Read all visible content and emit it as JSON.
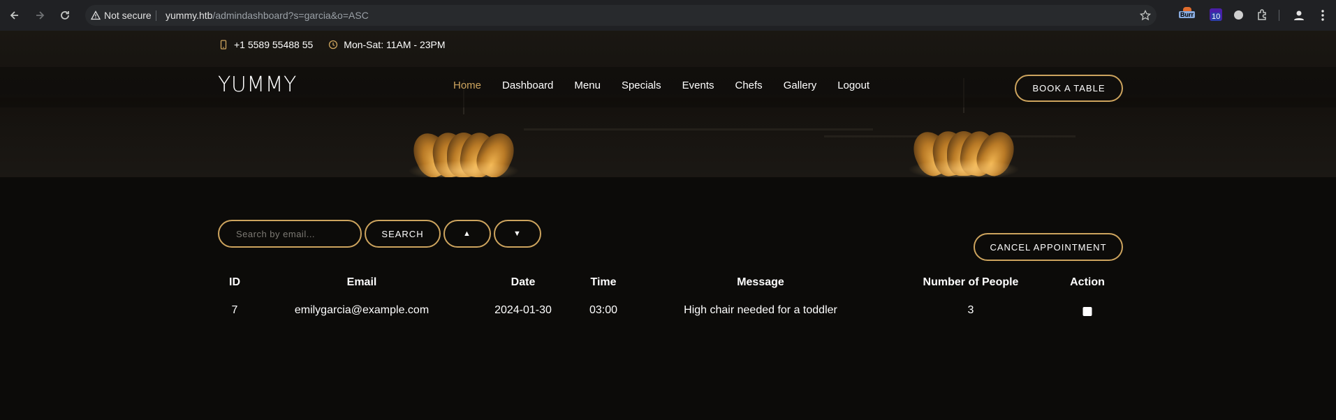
{
  "browser": {
    "security_label": "Not secure",
    "url_host": "yummy.htb",
    "url_path": "/admindashboard?s=garcia&o=ASC",
    "extensions": [
      {
        "name": "burp-icon",
        "badge": "Burr"
      },
      {
        "name": "extension-10-icon",
        "badge": "10"
      }
    ]
  },
  "topbar": {
    "phone": "+1 5589 55488 55",
    "hours": "Mon-Sat: 11AM - 23PM"
  },
  "header": {
    "logo": "YUMMY",
    "nav": [
      "Home",
      "Dashboard",
      "Menu",
      "Specials",
      "Events",
      "Chefs",
      "Gallery",
      "Logout"
    ],
    "active_nav": "Home",
    "book_label": "BOOK A TABLE"
  },
  "controls": {
    "search_placeholder": "Search by email...",
    "search_label": "SEARCH",
    "sort_asc_label": "▲",
    "sort_desc_label": "▼",
    "cancel_label": "CANCEL APPOINTMENT"
  },
  "table": {
    "columns": [
      "ID",
      "Email",
      "Date",
      "Time",
      "Message",
      "Number of People",
      "Action"
    ],
    "rows": [
      {
        "id": "7",
        "email": "emilygarcia@example.com",
        "date": "2024-01-30",
        "time": "03:00",
        "message": "High chair needed for a toddler",
        "people": "3",
        "action_checked": false
      }
    ]
  },
  "colors": {
    "accent": "#cda45e",
    "background": "#0c0b09",
    "chrome": "#202124"
  }
}
